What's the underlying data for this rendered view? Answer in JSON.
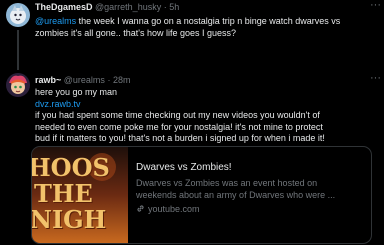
{
  "tweets": [
    {
      "display_name": "TheDgamesD",
      "handle": "@garreth_husky",
      "separator": "·",
      "time": "5h",
      "mention": "@urealms",
      "text_line1_rest": " the week I wanna go on a nostalgia trip n binge watch dwarves vs",
      "text_line2": "zombies it's all gone.. that's how life goes I guess?"
    },
    {
      "display_name": "rawb~",
      "handle": "@urealms",
      "separator": "·",
      "time": "28m",
      "line1": "here you go my man",
      "link": "dvz.rawb.tv",
      "body_lines": [
        "if you had spent some time checking out my new videos you wouldn't of",
        "needed to even come poke me for your nostalgia! it's not mine to protect",
        "bud if it matters to you! that's not a burden i signed up for when i made it!"
      ],
      "card": {
        "thumb_text": [
          "HOOS",
          "THE",
          "NIGH"
        ],
        "title": "Dwarves vs Zombies!",
        "desc_line1": "Dwarves vs Zombies was an event hosted on",
        "desc_line2": "weekends about an army of Dwarves who were ...",
        "domain": "youtube.com",
        "domain_icon": "link-icon"
      }
    }
  ],
  "colors": {
    "background": "#000000",
    "text": "#e7e9ea",
    "muted": "#71767b",
    "accent": "#1d9bf0",
    "border": "#2f3336"
  }
}
